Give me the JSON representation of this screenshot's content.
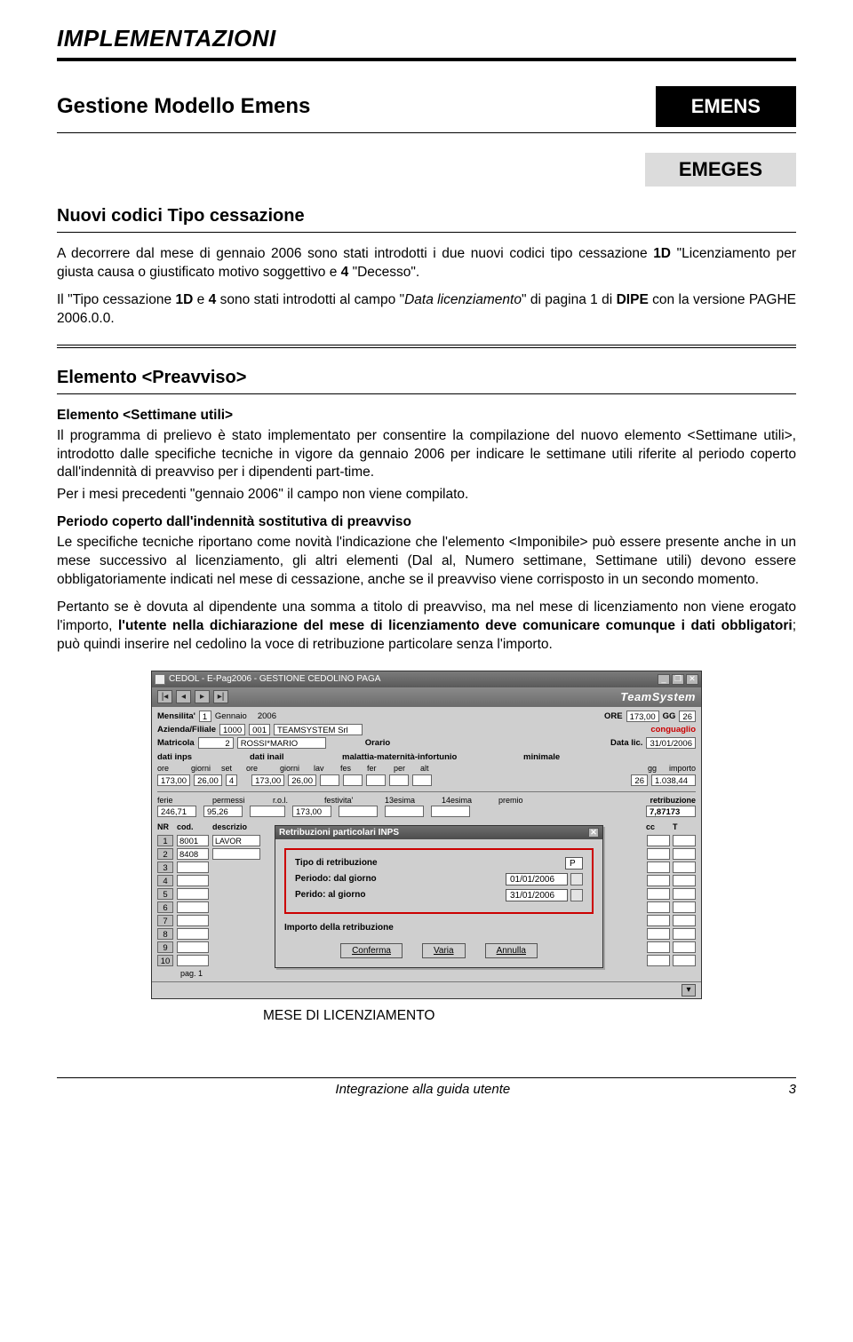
{
  "header": {
    "implementazioni": "IMPLEMENTAZIONI"
  },
  "title": {
    "main": "Gestione Modello Emens",
    "tag_black": "EMENS",
    "tag_grey": "EMEGES"
  },
  "section1": {
    "heading": "Nuovi codici Tipo cessazione",
    "p1_a": "A decorrere dal mese di gennaio 2006 sono stati introdotti i due nuovi codici tipo cessazione ",
    "p1_b": "1D",
    "p1_c": " \"Licenziamento per giusta causa o giustificato motivo soggettivo e ",
    "p1_d": "4",
    "p1_e": " \"Decesso\".",
    "p2_a": "Il \"Tipo cessazione ",
    "p2_b": "1D",
    "p2_c": " e ",
    "p2_d": "4",
    "p2_e": " sono stati introdotti al campo \"",
    "p2_f": "Data licenziamento",
    "p2_g": "\" di pagina 1 di ",
    "p2_h": "DIPE",
    "p2_i": " con la versione PAGHE 2006.0.0."
  },
  "section2": {
    "heading": "Elemento <Preavviso>",
    "sub1": "Elemento <Settimane utili>",
    "p1": "Il programma di prelievo è stato implementato per consentire la compilazione del nuovo elemento <Settimane utili>, introdotto dalle specifiche tecniche in vigore da gennaio 2006 per indicare le settimane utili riferite al periodo coperto dall'indennità di preavviso per i dipendenti part-time.",
    "p2": "Per i mesi precedenti \"gennaio 2006\" il campo non viene compilato.",
    "sub2": "Periodo coperto dall'indennità sostitutiva di preavviso",
    "p3": "Le specifiche tecniche riportano come novità l'indicazione che l'elemento <Imponibile> può essere presente anche in un mese successivo al licenziamento, gli altri elementi (Dal al, Numero settimane, Settimane utili) devono essere obbligatoriamente indicati nel mese di cessazione, anche se il preavviso viene corrisposto in un secondo momento.",
    "p4_a": "Pertanto se è dovuta al dipendente una somma a titolo di preavviso, ma nel mese di licenziamento non viene erogato l'importo, ",
    "p4_b": "l'utente nella dichiarazione del mese di licenziamento deve comunicare comunque i dati obbligatori",
    "p4_c": "; può quindi inserire nel cedolino la voce di retribuzione particolare senza l'importo."
  },
  "app": {
    "title": "CEDOL  - E-Pag2006  -  GESTIONE CEDOLINO PAGA",
    "brand": "TeamSystem",
    "labels": {
      "mensilita": "Mensilita'",
      "azienda": "Azienda/Filiale",
      "matricola": "Matricola",
      "orario": "Orario",
      "ore": "ORE",
      "gg": "GG",
      "conguaglio": "conguaglio",
      "datalic": "Data lic.",
      "dati_inps": "dati inps",
      "dati_inail": "dati inail",
      "malattia": "malattia-maternità-infortunio",
      "minimale": "minimale",
      "ore_h": "ore",
      "giorni_h": "giorni",
      "set_h": "set",
      "lav": "lav",
      "fes": "fes",
      "fer": "fer",
      "per": "per",
      "alt": "alt",
      "gg2": "gg",
      "importo": "importo",
      "ferie": "ferie",
      "permessi": "permessi",
      "rol": "r.o.l.",
      "festivita": "festivita'",
      "tredic": "13esima",
      "quatt": "14esima",
      "premio": "premio",
      "retribuzione": "retribuzione",
      "nr": "NR",
      "cod": "cod.",
      "descr": "descrizio",
      "cc": "cc",
      "T": "T",
      "pag": "pag. 1"
    },
    "values": {
      "mensilita": "1",
      "mese": "Gennaio",
      "anno": "2006",
      "az1": "1000",
      "az2": "001",
      "az_name": "TEAMSYSTEM Srl",
      "matricola": "2",
      "matr_name": "ROSSI*MARIO",
      "ore": "173,00",
      "gg": "26",
      "datalic": "31/01/2006",
      "inps_ore": "173,00",
      "inps_gg": "26,00",
      "inps_set": "4",
      "inail_ore": "173,00",
      "inail_gg": "26,00",
      "min_gg": "26",
      "min_imp": "1.038,44",
      "ferie": "246,71",
      "permessi": "95,26",
      "festivita": "173,00",
      "retribuzione": "7,87173",
      "rows": [
        "1",
        "2",
        "3",
        "4",
        "5",
        "6",
        "7",
        "8",
        "9",
        "10"
      ],
      "cod1": "8001",
      "desc1": "LAVOR",
      "cod2": "8408"
    },
    "dialog": {
      "title": "Retribuzioni particolari INPS",
      "r1": "Tipo di retribuzione",
      "r1v": "P",
      "r2": "Periodo: dal giorno",
      "r2v": "01/01/2006",
      "r3": "Perido: al giorno",
      "r3v": "31/01/2006",
      "imp": "Importo della retribuzione",
      "b1": "Conferma",
      "b2": "Varia",
      "b3": "Annulla"
    }
  },
  "figure_caption": "MESE DI LICENZIAMENTO",
  "footer": {
    "left": "Integrazione alla guida utente",
    "right": "3"
  }
}
